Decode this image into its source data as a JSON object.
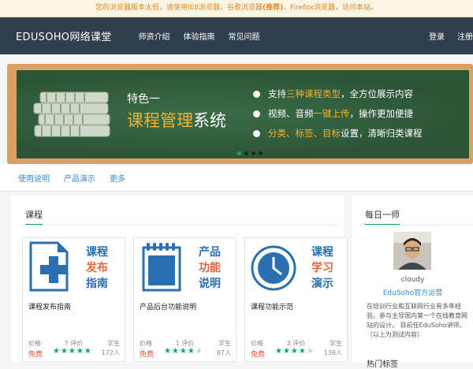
{
  "notice": {
    "prefix": "您的浏览器版本太低，请使用IE8浏览器、谷歌浏览器",
    "recommend": "(推荐)",
    "mid": "、Firefox浏览器",
    "suffix": "，访问本站。"
  },
  "navbar": {
    "brand": "EDUSOHO网络课堂",
    "items": [
      "师资介绍",
      "体验指南",
      "常见问题"
    ],
    "login": "登录",
    "register": "注册"
  },
  "banner": {
    "tag": "特色一",
    "headline_highlight": "课程管理",
    "headline_rest": "系统",
    "bullets": [
      {
        "pre": "支持",
        "hl": "三种课程类型",
        "post": "，全方位展示内容"
      },
      {
        "pre": "视频、音频",
        "hl": "一键上传",
        "post": "，操作更加便捷"
      },
      {
        "pre": "",
        "hl": "分类、标签、目标",
        "post": "设置，清晰归类课程"
      }
    ],
    "slide_count": 4,
    "active_slide": 0,
    "colors": {
      "board": "#2f5a3a",
      "frame": "#d9a061",
      "highlight": "#f2b233"
    }
  },
  "subnav": [
    "使用说明",
    "产品演示",
    "更多"
  ],
  "courses": {
    "title": "课程",
    "items": [
      {
        "thumb": [
          "课程",
          "发布",
          "指南"
        ],
        "title": "课程发布指南",
        "price_label": "价格",
        "price": "免费",
        "reviews": "7 评价",
        "rating": 5,
        "students_label": "学生",
        "students": "172人",
        "icon": "document-plus-icon"
      },
      {
        "thumb": [
          "产品",
          "功能",
          "说明"
        ],
        "title": "产品后台功能说明",
        "price_label": "价格",
        "price": "免费",
        "reviews": "1 评价",
        "rating": 4,
        "students_label": "学生",
        "students": "87人",
        "icon": "notepad-icon"
      },
      {
        "thumb": [
          "课程",
          "学习",
          "演示"
        ],
        "title": "课程功能示范",
        "price_label": "价格",
        "price": "免费",
        "reviews": "3 评价",
        "rating": 4,
        "students_label": "学生",
        "students": "136人",
        "icon": "clock-icon"
      }
    ]
  },
  "teacher": {
    "title": "每日一师",
    "name": "cloudy",
    "desc": "EduSoho官方运营",
    "bio": "在培训行业和互联网行业有多年经验。参与主导国内第一个在线教育网站的设计。 目前任EduSoho讲师。（以上为测试内容）"
  },
  "side_next": "热门标签"
}
